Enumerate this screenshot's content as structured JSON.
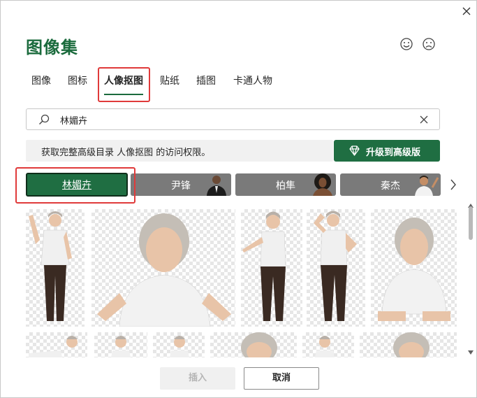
{
  "dialog": {
    "title": "图像集",
    "close_icon": "close-icon",
    "feedback": {
      "happy_icon": "smile-icon",
      "sad_icon": "frown-icon"
    }
  },
  "tabs": [
    {
      "label": "图像",
      "active": false
    },
    {
      "label": "图标",
      "active": false
    },
    {
      "label": "人像抠图",
      "active": true
    },
    {
      "label": "贴纸",
      "active": false
    },
    {
      "label": "插图",
      "active": false
    },
    {
      "label": "卡通人物",
      "active": false
    }
  ],
  "search": {
    "value": "林媚卉",
    "icon": "search-icon",
    "clear_icon": "clear-icon"
  },
  "banner": {
    "text": "获取完整高级目录 人像抠图 的访问权限。",
    "upgrade_label": "升级到高级版",
    "upgrade_icon": "diamond-icon"
  },
  "people": [
    {
      "label": "林媚卉",
      "active": true
    },
    {
      "label": "尹锋",
      "active": false
    },
    {
      "label": "柏隼",
      "active": false
    },
    {
      "label": "秦杰",
      "active": false
    }
  ],
  "footer": {
    "insert_label": "插入",
    "cancel_label": "取消"
  },
  "colors": {
    "accent": "#1f6e42",
    "title": "#1b6b3d",
    "highlight": "#e03a3a",
    "chip_inactive": "#7a7a7a"
  }
}
